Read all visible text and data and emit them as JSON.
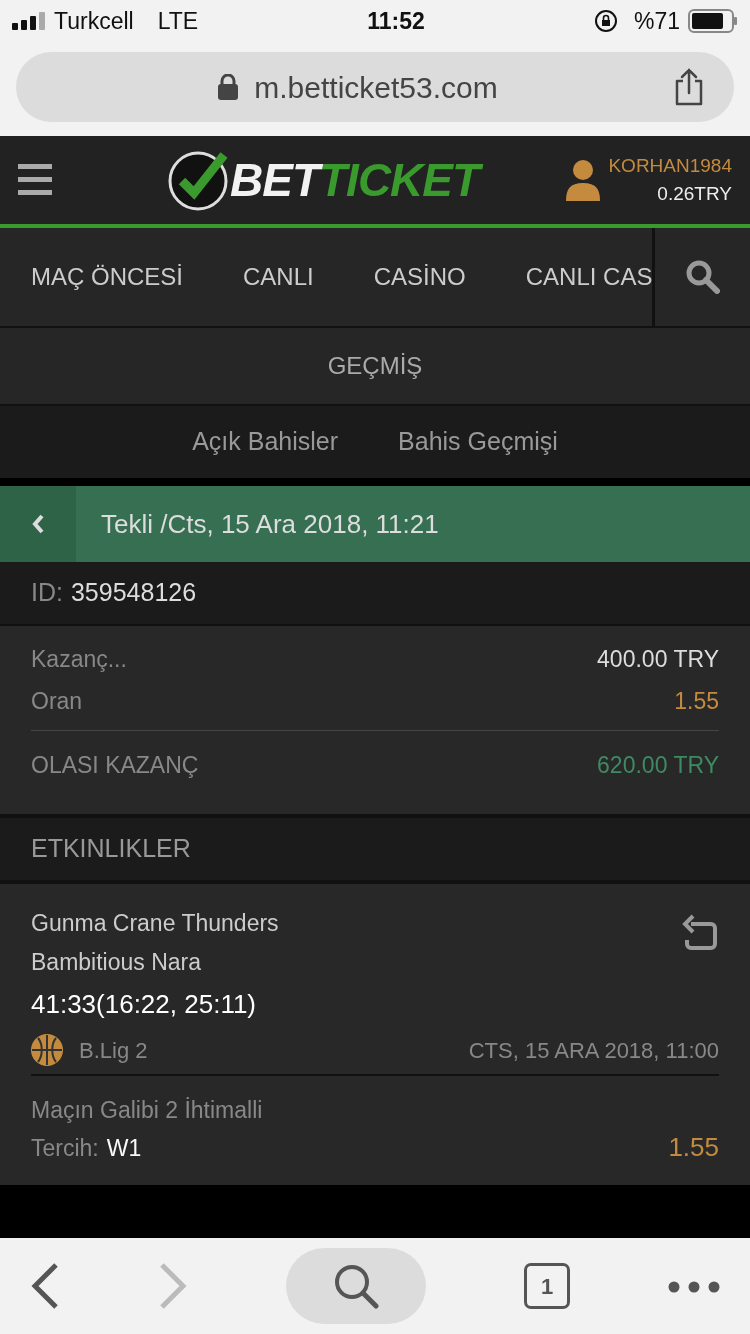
{
  "status_bar": {
    "carrier": "Turkcell",
    "network": "LTE",
    "time": "11:52",
    "battery": "%71"
  },
  "browser": {
    "url": "m.betticket53.com"
  },
  "header": {
    "logo": [
      {
        "text": "BET",
        "color": "#f2f2f2"
      },
      {
        "text": "TICKET",
        "color": "#3a9a2e"
      }
    ],
    "username": "KORHAN1984",
    "balance": "0.26TRY"
  },
  "nav_tabs": [
    {
      "label": "MAÇ ÖNCESİ",
      "selected": false
    },
    {
      "label": "CANLI",
      "selected": false
    },
    {
      "label": "CASİNO",
      "selected": false
    },
    {
      "label": "CANLI CAS",
      "selected": false
    }
  ],
  "section_title": "GEÇMİŞ",
  "sub_tabs": [
    {
      "label": "Açık Bahisler",
      "selected": false
    },
    {
      "label": "Bahis Geçmişi",
      "selected": false
    }
  ],
  "bet": {
    "title": "Tekli /Cts, 15 Ara 2018, 11:21",
    "id_label": "ID:",
    "id": "359548126",
    "rows": [
      {
        "label": "Kazanç...",
        "value": "400.00 TRY",
        "kind": "plain"
      },
      {
        "label": "Oran",
        "value": "1.55",
        "kind": "odds"
      },
      {
        "label": "OLASI KAZANÇ",
        "value": "620.00 TRY",
        "kind": "win"
      }
    ]
  },
  "events_title": "ETKINLIKLER",
  "events": [
    {
      "team1": "Gunma Crane Thunders",
      "team2": "Bambitious Nara",
      "score": "41:33(16:22, 25:11)",
      "league": "B.Lig 2",
      "date": "CTS, 15 ARA 2018, 11:00",
      "market": "Maçın Galibi 2 İhtimalli",
      "choice_label": "Tercih:",
      "choice": "W1",
      "odds": "1.55"
    }
  ],
  "toolbar": {
    "tab_count": "1"
  }
}
